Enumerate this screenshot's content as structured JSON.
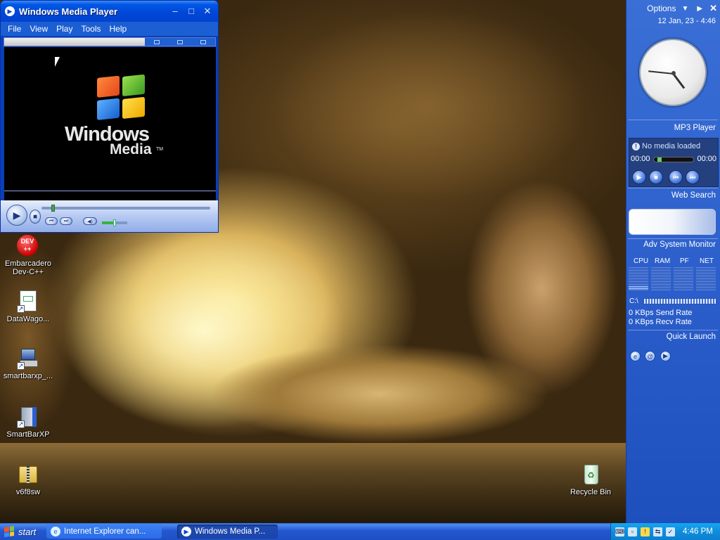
{
  "wmp": {
    "title": "Windows Media Player",
    "menu": [
      "File",
      "View",
      "Play",
      "Tools",
      "Help"
    ],
    "logo_text": "Windows",
    "logo_text2": "Media",
    "logo_tm": "TM"
  },
  "sidebar": {
    "options_label": "Options",
    "date_time": "12 Jan, 23 - 4:46",
    "clock": {
      "hour": 4,
      "minute": 46
    },
    "mp3_title": "MP3 Player",
    "mp3_status": "No media loaded",
    "mp3_time_start": "00:00",
    "mp3_time_end": "00:00",
    "web_search_title": "Web Search",
    "monitor_title": "Adv System Monitor",
    "monitor_labels": [
      "CPU",
      "RAM",
      "PF",
      "NET"
    ],
    "drive_label": "C:\\",
    "send_rate": "0 KBps Send Rate",
    "recv_rate": "0 KBps Recv Rate",
    "quick_launch_title": "Quick Launch"
  },
  "desktop": {
    "icons": [
      {
        "label": "Embarcadero Dev-C++",
        "line1": "Embarcadero",
        "line2": "Dev-C++",
        "glyph_text": "DEV ++"
      },
      {
        "label": "DataWago..."
      },
      {
        "label": "smartbarxp_..."
      },
      {
        "label": "SmartBarXP"
      },
      {
        "label": "v6f8sw"
      },
      {
        "label": "Recycle Bin"
      }
    ]
  },
  "taskbar": {
    "start_label": "start",
    "tasks": [
      {
        "label": "Internet Explorer can..."
      },
      {
        "label": "Windows Media P..."
      }
    ],
    "clock": "4:46 PM"
  },
  "colors": {
    "xp_blue": "#0046d5",
    "sidebar_blue": "#2d60cc",
    "tray_blue": "#0f8ddb"
  }
}
